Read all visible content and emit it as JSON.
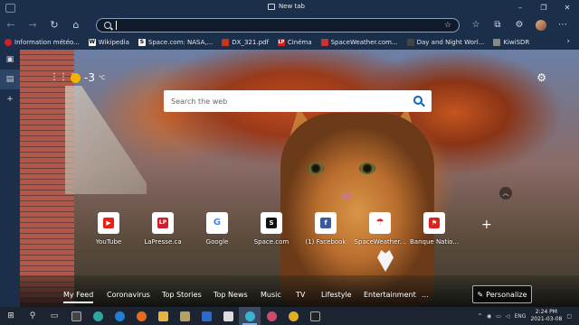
{
  "window": {
    "tab_title": "New tab"
  },
  "address": {
    "placeholder": ""
  },
  "bookmarks": [
    {
      "label": "Information météo...",
      "color": "#d0202a",
      "icon": "weather-icon"
    },
    {
      "label": "Wikipedia",
      "color": "#ffffff",
      "icon": "wikipedia-icon",
      "glyph": "W"
    },
    {
      "label": "Space.com: NASA,...",
      "color": "#ffffff",
      "icon": "space-icon",
      "glyph": "S"
    },
    {
      "label": "DX_321.pdf",
      "color": "#c8321e",
      "icon": "pdf-icon"
    },
    {
      "label": "Cinéma",
      "color": "#d0202a",
      "icon": "lapresse-icon",
      "glyph": "LP"
    },
    {
      "label": "SpaceWeather.com...",
      "color": "#c83232",
      "icon": "spaceweather-icon"
    },
    {
      "label": "Day and Night Worl...",
      "color": "#444444",
      "icon": "daynight-icon"
    },
    {
      "label": "KiwiSDR",
      "color": "#888888",
      "icon": "kiwisdr-icon"
    }
  ],
  "weather": {
    "temp": "-3",
    "unit": "°C"
  },
  "search": {
    "placeholder": "Search the web"
  },
  "quick_links": [
    {
      "label": "YouTube",
      "color": "#e62117",
      "glyph": "▶"
    },
    {
      "label": "LaPresse.ca",
      "color": "#d0202a",
      "glyph": "LP"
    },
    {
      "label": "Google",
      "color": "#4285f4",
      "glyph": "G"
    },
    {
      "label": "Space.com",
      "color": "#111111",
      "glyph": "S"
    },
    {
      "label": "(1) Facebook",
      "color": "#3b5998",
      "glyph": "f"
    },
    {
      "label": "SpaceWeather...",
      "color": "#d02828",
      "glyph": "☂"
    },
    {
      "label": "Banque Natio...",
      "color": "#e0201a",
      "glyph": "⚑"
    }
  ],
  "feed": {
    "items": [
      "My Feed",
      "Coronavirus",
      "Top Stories",
      "Top News",
      "Music",
      "TV",
      "Lifestyle",
      "Entertainment",
      "..."
    ],
    "personalize": "Personalize"
  },
  "taskbar": {
    "lang": "ENG",
    "time": "2:24 PM",
    "date": "2021-03-08"
  }
}
